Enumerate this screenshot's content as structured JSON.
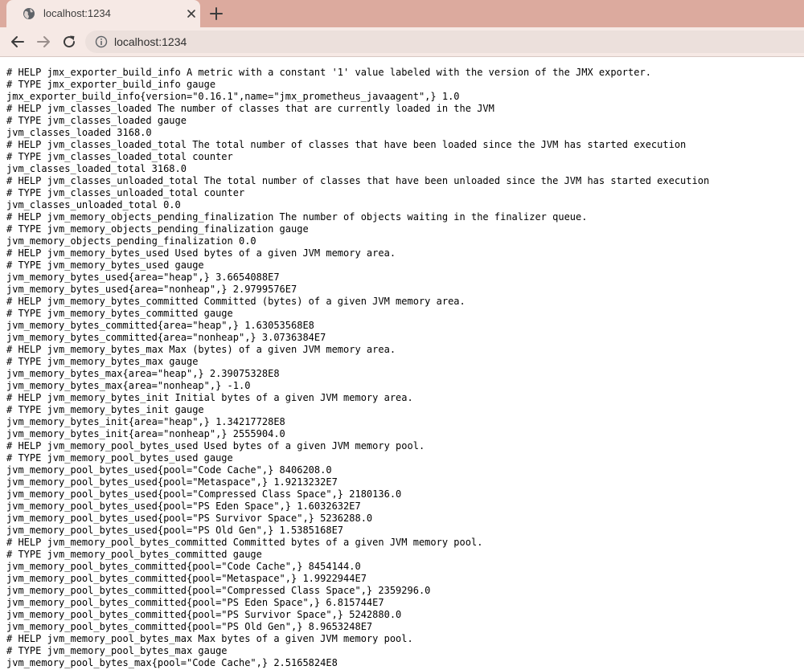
{
  "browser": {
    "tab_title": "localhost:1234",
    "url": "localhost:1234",
    "icons": {
      "favicon": "globe-icon",
      "close": "close-icon",
      "new_tab": "plus-icon",
      "back": "arrow-left-icon",
      "forward": "arrow-right-icon",
      "reload": "reload-icon",
      "site_info": "info-icon"
    },
    "colors": {
      "tabstrip": "#dcaa9e",
      "active_tab": "#f6e9e5",
      "omnibox": "#ece0dc"
    }
  },
  "page": {
    "lines": [
      "# HELP jmx_exporter_build_info A metric with a constant '1' value labeled with the version of the JMX exporter.",
      "# TYPE jmx_exporter_build_info gauge",
      "jmx_exporter_build_info{version=\"0.16.1\",name=\"jmx_prometheus_javaagent\",} 1.0",
      "# HELP jvm_classes_loaded The number of classes that are currently loaded in the JVM",
      "# TYPE jvm_classes_loaded gauge",
      "jvm_classes_loaded 3168.0",
      "# HELP jvm_classes_loaded_total The total number of classes that have been loaded since the JVM has started execution",
      "# TYPE jvm_classes_loaded_total counter",
      "jvm_classes_loaded_total 3168.0",
      "# HELP jvm_classes_unloaded_total The total number of classes that have been unloaded since the JVM has started execution",
      "# TYPE jvm_classes_unloaded_total counter",
      "jvm_classes_unloaded_total 0.0",
      "# HELP jvm_memory_objects_pending_finalization The number of objects waiting in the finalizer queue.",
      "# TYPE jvm_memory_objects_pending_finalization gauge",
      "jvm_memory_objects_pending_finalization 0.0",
      "# HELP jvm_memory_bytes_used Used bytes of a given JVM memory area.",
      "# TYPE jvm_memory_bytes_used gauge",
      "jvm_memory_bytes_used{area=\"heap\",} 3.6654088E7",
      "jvm_memory_bytes_used{area=\"nonheap\",} 2.9799576E7",
      "# HELP jvm_memory_bytes_committed Committed (bytes) of a given JVM memory area.",
      "# TYPE jvm_memory_bytes_committed gauge",
      "jvm_memory_bytes_committed{area=\"heap\",} 1.63053568E8",
      "jvm_memory_bytes_committed{area=\"nonheap\",} 3.0736384E7",
      "# HELP jvm_memory_bytes_max Max (bytes) of a given JVM memory area.",
      "# TYPE jvm_memory_bytes_max gauge",
      "jvm_memory_bytes_max{area=\"heap\",} 2.39075328E8",
      "jvm_memory_bytes_max{area=\"nonheap\",} -1.0",
      "# HELP jvm_memory_bytes_init Initial bytes of a given JVM memory area.",
      "# TYPE jvm_memory_bytes_init gauge",
      "jvm_memory_bytes_init{area=\"heap\",} 1.34217728E8",
      "jvm_memory_bytes_init{area=\"nonheap\",} 2555904.0",
      "# HELP jvm_memory_pool_bytes_used Used bytes of a given JVM memory pool.",
      "# TYPE jvm_memory_pool_bytes_used gauge",
      "jvm_memory_pool_bytes_used{pool=\"Code Cache\",} 8406208.0",
      "jvm_memory_pool_bytes_used{pool=\"Metaspace\",} 1.9213232E7",
      "jvm_memory_pool_bytes_used{pool=\"Compressed Class Space\",} 2180136.0",
      "jvm_memory_pool_bytes_used{pool=\"PS Eden Space\",} 1.6032632E7",
      "jvm_memory_pool_bytes_used{pool=\"PS Survivor Space\",} 5236288.0",
      "jvm_memory_pool_bytes_used{pool=\"PS Old Gen\",} 1.5385168E7",
      "# HELP jvm_memory_pool_bytes_committed Committed bytes of a given JVM memory pool.",
      "# TYPE jvm_memory_pool_bytes_committed gauge",
      "jvm_memory_pool_bytes_committed{pool=\"Code Cache\",} 8454144.0",
      "jvm_memory_pool_bytes_committed{pool=\"Metaspace\",} 1.9922944E7",
      "jvm_memory_pool_bytes_committed{pool=\"Compressed Class Space\",} 2359296.0",
      "jvm_memory_pool_bytes_committed{pool=\"PS Eden Space\",} 6.815744E7",
      "jvm_memory_pool_bytes_committed{pool=\"PS Survivor Space\",} 5242880.0",
      "jvm_memory_pool_bytes_committed{pool=\"PS Old Gen\",} 8.9653248E7",
      "# HELP jvm_memory_pool_bytes_max Max bytes of a given JVM memory pool.",
      "# TYPE jvm_memory_pool_bytes_max gauge",
      "jvm_memory_pool_bytes_max{pool=\"Code Cache\",} 2.5165824E8"
    ]
  }
}
